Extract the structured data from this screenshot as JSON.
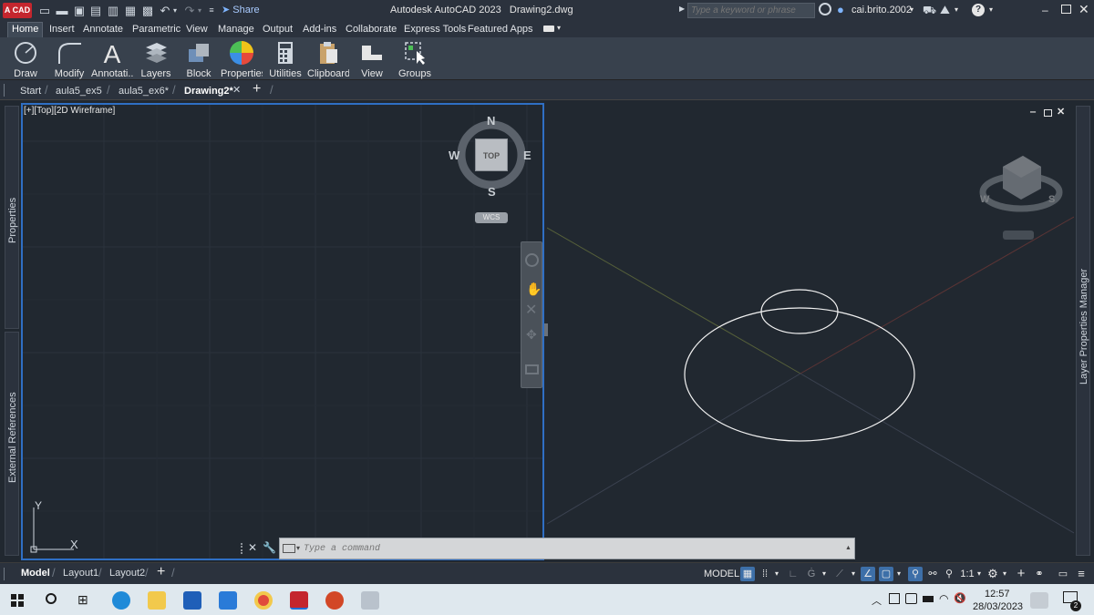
{
  "titlebar": {
    "app_badge": "A CAD",
    "share_label": "Share",
    "title": "Autodesk AutoCAD 2023",
    "filename": "Drawing2.dwg",
    "search_placeholder": "Type a keyword or phrase",
    "user": "cai.brito.2002"
  },
  "menu": {
    "items": [
      "Home",
      "Insert",
      "Annotate",
      "Parametric",
      "View",
      "Manage",
      "Output",
      "Add-ins",
      "Collaborate",
      "Express Tools",
      "Featured Apps"
    ]
  },
  "ribbon": {
    "buttons": [
      "Draw",
      "Modify",
      "Annotati...",
      "Layers",
      "Block",
      "Properties",
      "Utilities",
      "Clipboard",
      "View",
      "Groups"
    ]
  },
  "filetabs": {
    "tabs": [
      "Start",
      "aula5_ex5",
      "aula5_ex6*",
      "Drawing2*"
    ],
    "new_tab": "+"
  },
  "viewport_left": {
    "label": "[+][Top][2D Wireframe]",
    "compass": {
      "n": "N",
      "s": "S",
      "e": "E",
      "w": "W",
      "top": "TOP",
      "wcs": "WCS"
    },
    "ucs": {
      "x": "X",
      "y": "Y"
    }
  },
  "viewport_right": {
    "cube_labels": {
      "w": "W",
      "s": "S"
    }
  },
  "side_panels": {
    "properties": "Properties",
    "external_references": "External References",
    "layer_manager": "Layer Properties Manager"
  },
  "command": {
    "placeholder": "Type a command"
  },
  "layouts": {
    "tabs": [
      "Model",
      "Layout1",
      "Layout2"
    ],
    "add": "+"
  },
  "status": {
    "model": "MODEL",
    "scale": "1:1"
  },
  "taskbar": {
    "time": "12:57",
    "date": "28/03/2023",
    "notif_count": "2"
  },
  "colors": {
    "accent": "#3d6fa8",
    "viewport_border": "#2f6fc4",
    "background": "#212830"
  }
}
